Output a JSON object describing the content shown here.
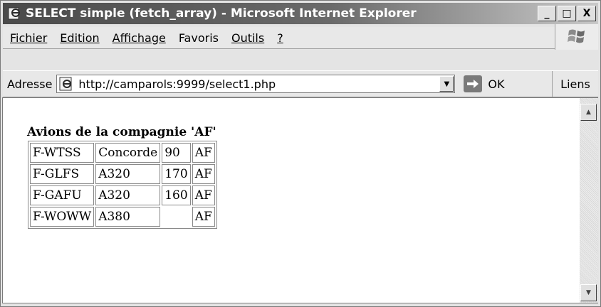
{
  "window": {
    "title": "SELECT simple (fetch_array) - Microsoft Internet Explorer",
    "buttons": [
      "_",
      "□",
      "X"
    ]
  },
  "menu": {
    "items": [
      {
        "label": "Fichier",
        "underline": "F"
      },
      {
        "label": "Edition",
        "underline": "E"
      },
      {
        "label": "Affichage",
        "underline": "A"
      },
      {
        "label": "Favoris",
        "underline": "v"
      },
      {
        "label": "Outils",
        "underline": "O"
      },
      {
        "label": "?",
        "underline": "?"
      }
    ]
  },
  "address": {
    "label": "Adresse",
    "url": "http://camparols:9999/select1.php",
    "go_label": "OK",
    "links_label": "Liens"
  },
  "page": {
    "heading": "Avions de la compagnie 'AF'",
    "rows": [
      [
        "F-WTSS",
        "Concorde",
        "90",
        "AF"
      ],
      [
        "F-GLFS",
        "A320",
        "170",
        "AF"
      ],
      [
        "F-GAFU",
        "A320",
        "160",
        "AF"
      ],
      [
        "F-WOWW",
        "A380",
        "",
        "AF"
      ]
    ]
  },
  "icons": [
    "ie-page-icon",
    "windows-logo-icon",
    "ie-address-icon",
    "dropdown-arrow-icon",
    "go-arrow-icon",
    "scroll-up-icon",
    "scroll-down-icon"
  ]
}
